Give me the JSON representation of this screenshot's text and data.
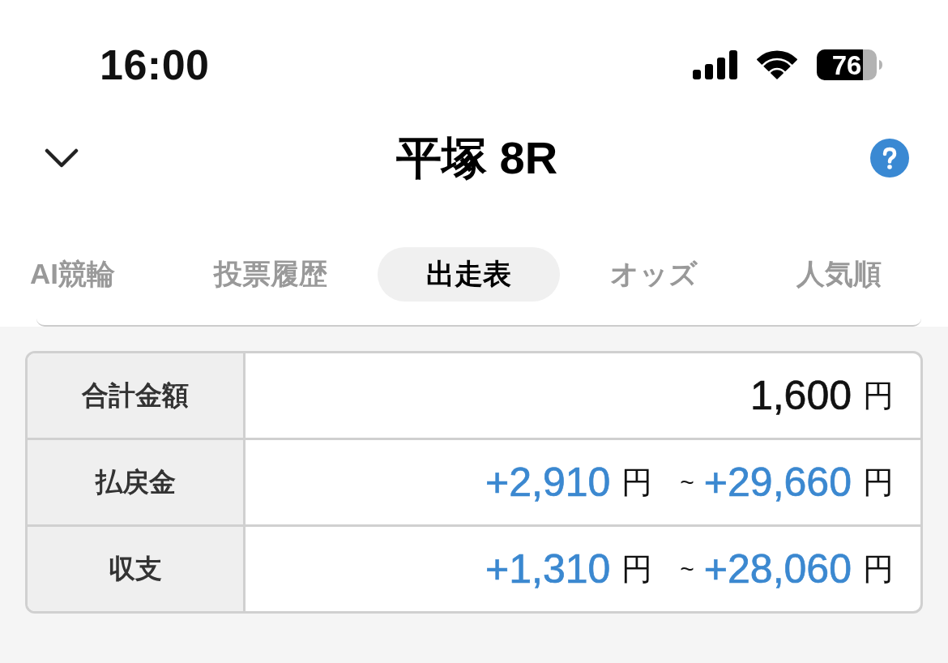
{
  "status_bar": {
    "time": "16:00",
    "battery": "76"
  },
  "header": {
    "title": "平塚 8R"
  },
  "tabs": [
    {
      "label": "AI競輪",
      "selected": false
    },
    {
      "label": "投票履歴",
      "selected": false
    },
    {
      "label": "出走表",
      "selected": true
    },
    {
      "label": "オッズ",
      "selected": false
    },
    {
      "label": "人気順",
      "selected": false
    }
  ],
  "summary": {
    "rows": [
      {
        "label": "合計金額",
        "kind": "total",
        "amounts": [
          {
            "value": "1,600",
            "unit": "円"
          }
        ]
      },
      {
        "label": "払戻金",
        "kind": "range",
        "amounts": [
          {
            "value": "+2,910",
            "unit": "円"
          },
          {
            "value": "+29,660",
            "unit": "円"
          }
        ],
        "separator": "~"
      },
      {
        "label": "収支",
        "kind": "range",
        "amounts": [
          {
            "value": "+1,310",
            "unit": "円"
          },
          {
            "value": "+28,060",
            "unit": "円"
          }
        ],
        "separator": "~"
      }
    ]
  }
}
